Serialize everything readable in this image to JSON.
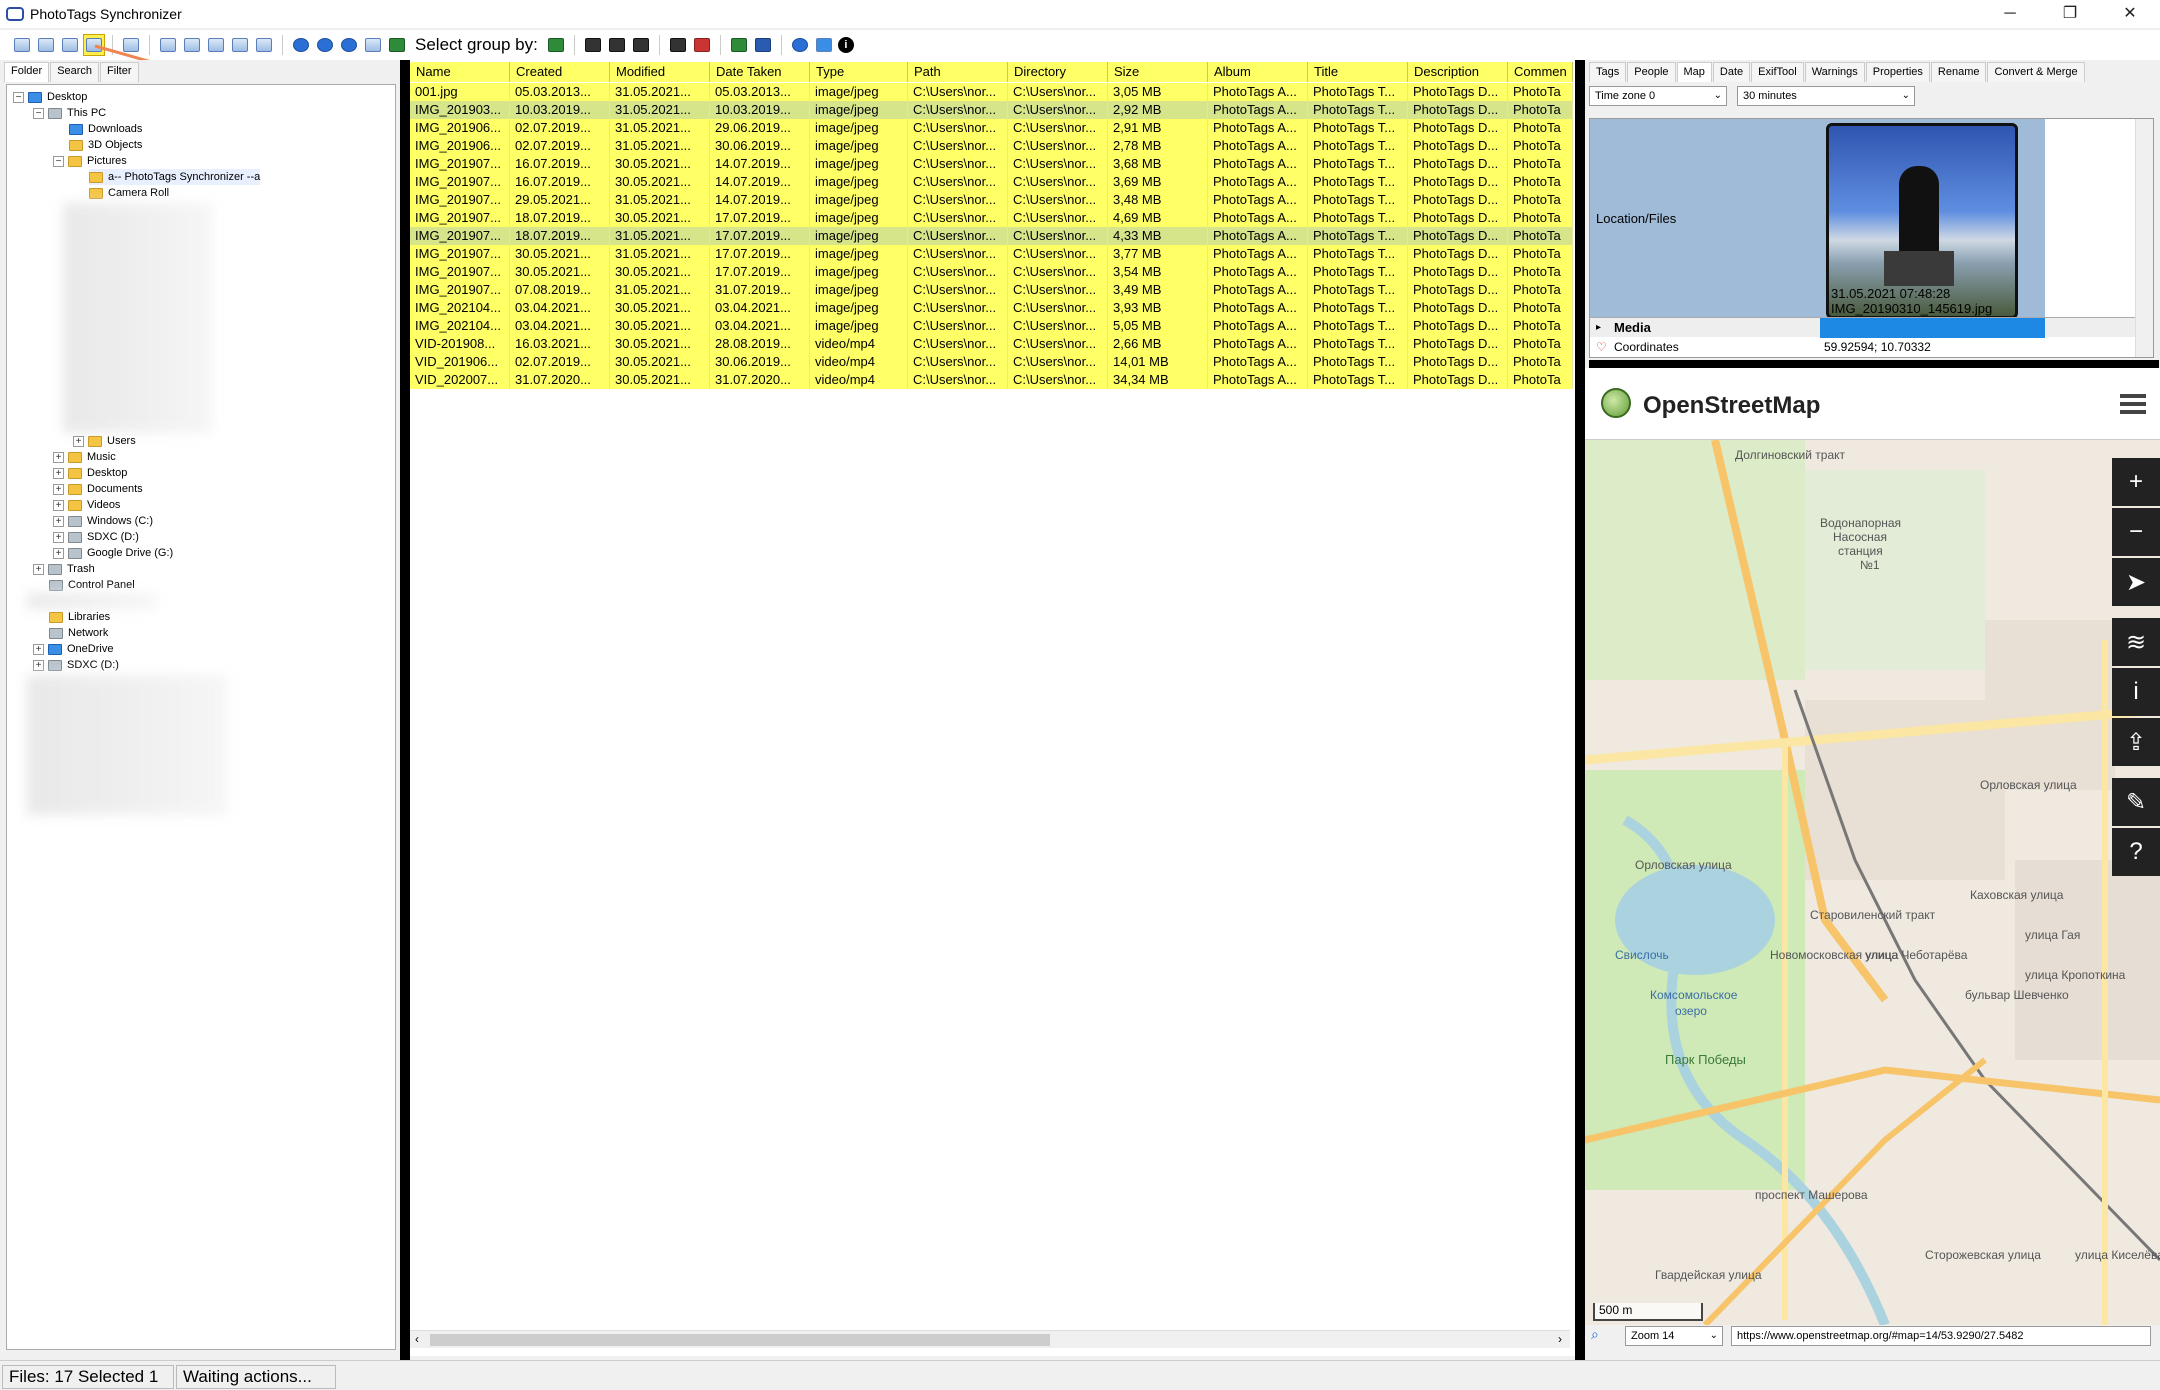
{
  "app": {
    "title": "PhotoTags Synchronizer",
    "minimize": "─",
    "maximize": "❐",
    "close": "✕"
  },
  "toolbar": {
    "select_group_label": "Select group by:",
    "info": "i"
  },
  "left_tabs": [
    "Folder",
    "Search",
    "Filter"
  ],
  "tree": {
    "desktop": "Desktop",
    "this_pc": "This PC",
    "downloads": "Downloads",
    "objects3d": "3D Objects",
    "pictures": "Pictures",
    "phototags": "a-- PhotoTags Synchronizer --a",
    "camera_roll": "Camera Roll",
    "users": "Users",
    "music": "Music",
    "desktop2": "Desktop",
    "documents": "Documents",
    "videos": "Videos",
    "windows_c": "Windows (C:)",
    "sdxc_d": "SDXC (D:)",
    "gdrive": "Google Drive (G:)",
    "trash": "Trash",
    "control_panel": "Control Panel",
    "libraries": "Libraries",
    "network": "Network",
    "onedrive": "OneDrive",
    "sdxc_d2": "SDXC (D:)"
  },
  "grid": {
    "columns": [
      "Name",
      "Created",
      "Modified",
      "Date Taken",
      "Type",
      "Path",
      "Directory",
      "Size",
      "Album",
      "Title",
      "Description",
      "Commen"
    ],
    "rows": [
      [
        "001.jpg",
        "05.03.2013...",
        "31.05.2021...",
        "05.03.2013...",
        "image/jpeg",
        "C:\\Users\\nor...",
        "C:\\Users\\nor...",
        "3,05 MB",
        "PhotoTags A...",
        "PhotoTags T...",
        "PhotoTags D...",
        "PhotoTa"
      ],
      [
        "IMG_201903...",
        "10.03.2019...",
        "31.05.2021...",
        "10.03.2019...",
        "image/jpeg",
        "C:\\Users\\nor...",
        "C:\\Users\\nor...",
        "2,92 MB",
        "PhotoTags A...",
        "PhotoTags T...",
        "PhotoTags D...",
        "PhotoTa"
      ],
      [
        "IMG_201906...",
        "02.07.2019...",
        "31.05.2021...",
        "29.06.2019...",
        "image/jpeg",
        "C:\\Users\\nor...",
        "C:\\Users\\nor...",
        "2,91 MB",
        "PhotoTags A...",
        "PhotoTags T...",
        "PhotoTags D...",
        "PhotoTa"
      ],
      [
        "IMG_201906...",
        "02.07.2019...",
        "31.05.2021...",
        "30.06.2019...",
        "image/jpeg",
        "C:\\Users\\nor...",
        "C:\\Users\\nor...",
        "2,78 MB",
        "PhotoTags A...",
        "PhotoTags T...",
        "PhotoTags D...",
        "PhotoTa"
      ],
      [
        "IMG_201907...",
        "16.07.2019...",
        "30.05.2021...",
        "14.07.2019...",
        "image/jpeg",
        "C:\\Users\\nor...",
        "C:\\Users\\nor...",
        "3,68 MB",
        "PhotoTags A...",
        "PhotoTags T...",
        "PhotoTags D...",
        "PhotoTa"
      ],
      [
        "IMG_201907...",
        "16.07.2019...",
        "30.05.2021...",
        "14.07.2019...",
        "image/jpeg",
        "C:\\Users\\nor...",
        "C:\\Users\\nor...",
        "3,69 MB",
        "PhotoTags A...",
        "PhotoTags T...",
        "PhotoTags D...",
        "PhotoTa"
      ],
      [
        "IMG_201907...",
        "29.05.2021...",
        "31.05.2021...",
        "14.07.2019...",
        "image/jpeg",
        "C:\\Users\\nor...",
        "C:\\Users\\nor...",
        "3,48 MB",
        "PhotoTags A...",
        "PhotoTags T...",
        "PhotoTags D...",
        "PhotoTa"
      ],
      [
        "IMG_201907...",
        "18.07.2019...",
        "30.05.2021...",
        "17.07.2019...",
        "image/jpeg",
        "C:\\Users\\nor...",
        "C:\\Users\\nor...",
        "4,69 MB",
        "PhotoTags A...",
        "PhotoTags T...",
        "PhotoTags D...",
        "PhotoTa"
      ],
      [
        "IMG_201907...",
        "18.07.2019...",
        "31.05.2021...",
        "17.07.2019...",
        "image/jpeg",
        "C:\\Users\\nor...",
        "C:\\Users\\nor...",
        "4,33 MB",
        "PhotoTags A...",
        "PhotoTags T...",
        "PhotoTags D...",
        "PhotoTa"
      ],
      [
        "IMG_201907...",
        "30.05.2021...",
        "31.05.2021...",
        "17.07.2019...",
        "image/jpeg",
        "C:\\Users\\nor...",
        "C:\\Users\\nor...",
        "3,77 MB",
        "PhotoTags A...",
        "PhotoTags T...",
        "PhotoTags D...",
        "PhotoTa"
      ],
      [
        "IMG_201907...",
        "30.05.2021...",
        "30.05.2021...",
        "17.07.2019...",
        "image/jpeg",
        "C:\\Users\\nor...",
        "C:\\Users\\nor...",
        "3,54 MB",
        "PhotoTags A...",
        "PhotoTags T...",
        "PhotoTags D...",
        "PhotoTa"
      ],
      [
        "IMG_201907...",
        "07.08.2019...",
        "31.05.2021...",
        "31.07.2019...",
        "image/jpeg",
        "C:\\Users\\nor...",
        "C:\\Users\\nor...",
        "3,49 MB",
        "PhotoTags A...",
        "PhotoTags T...",
        "PhotoTags D...",
        "PhotoTa"
      ],
      [
        "IMG_202104...",
        "03.04.2021...",
        "30.05.2021...",
        "03.04.2021...",
        "image/jpeg",
        "C:\\Users\\nor...",
        "C:\\Users\\nor...",
        "3,93 MB",
        "PhotoTags A...",
        "PhotoTags T...",
        "PhotoTags D...",
        "PhotoTa"
      ],
      [
        "IMG_202104...",
        "03.04.2021...",
        "30.05.2021...",
        "03.04.2021...",
        "image/jpeg",
        "C:\\Users\\nor...",
        "C:\\Users\\nor...",
        "5,05 MB",
        "PhotoTags A...",
        "PhotoTags T...",
        "PhotoTags D...",
        "PhotoTa"
      ],
      [
        "VID-201908...",
        "16.03.2021...",
        "30.05.2021...",
        "28.08.2019...",
        "video/mp4",
        "C:\\Users\\nor...",
        "C:\\Users\\nor...",
        "2,66 MB",
        "PhotoTags A...",
        "PhotoTags T...",
        "PhotoTags D...",
        "PhotoTa"
      ],
      [
        "VID_201906...",
        "02.07.2019...",
        "30.05.2021...",
        "30.06.2019...",
        "video/mp4",
        "C:\\Users\\nor...",
        "C:\\Users\\nor...",
        "14,01 MB",
        "PhotoTags A...",
        "PhotoTags T...",
        "PhotoTags D...",
        "PhotoTa"
      ],
      [
        "VID_202007...",
        "31.07.2020...",
        "30.05.2021...",
        "31.07.2020...",
        "video/mp4",
        "C:\\Users\\nor...",
        "C:\\Users\\nor...",
        "34,34 MB",
        "PhotoTags A...",
        "PhotoTags T...",
        "PhotoTags D...",
        "PhotoTa"
      ]
    ],
    "selected_rows": [
      1,
      8
    ]
  },
  "right_tabs": [
    "Tags",
    "People",
    "Map",
    "Date",
    "ExifTool",
    "Warnings",
    "Properties",
    "Rename",
    "Convert & Merge"
  ],
  "right_active_tab": "Map",
  "map_controls": {
    "timezone": "Time zone 0",
    "interval": "30 minutes"
  },
  "metadata": {
    "location_label": "Location/Files",
    "thumb_date": "31.05.2021 07:48:28",
    "thumb_file": "IMG_20190310_145619.jpg",
    "media_label": "Media",
    "coord_label": "Coordinates",
    "coord_value": "59.92594; 10.70332"
  },
  "osm": {
    "title": "OpenStreetMap",
    "labels": [
      "Водонапорная",
      "Насосная",
      "станция",
      "№1",
      "Орловская улица",
      "Орловская улица",
      "Каховская улица",
      "Комсомольское",
      "озеро",
      "Парк Победы",
      "Свислочь",
      "проспект Машерова",
      "улица Кропоткина",
      "улица Киселёва",
      "Старовиленский тракт",
      "Долгиновский тракт",
      "улица Чеботарёва",
      "бульвар Шевченко",
      "Новомосковская улица",
      "Гвардейская улица",
      "Сторожевская улица",
      "улица Гая"
    ],
    "scale": "500 m",
    "zoom": "Zoom 14",
    "url": "https://www.openstreetmap.org/#map=14/53.9290/27.5482"
  },
  "status": {
    "files": "Files: 17 Selected 1",
    "action": "Waiting actions..."
  },
  "colors": {
    "row_bg": "#ffff66",
    "selected_row": "#d6e58a",
    "accent": "#1e88e5"
  }
}
